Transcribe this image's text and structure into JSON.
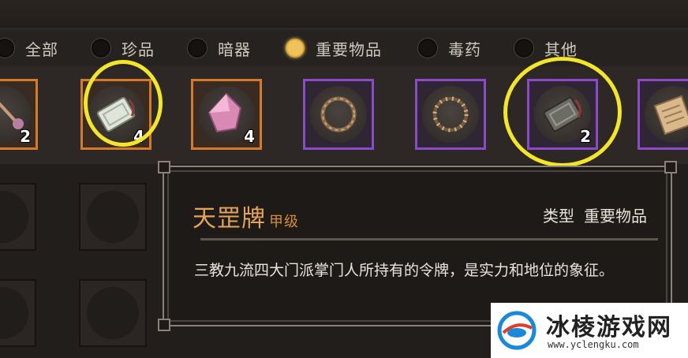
{
  "tabs": [
    {
      "label": "全部",
      "selected": false
    },
    {
      "label": "珍品",
      "selected": false
    },
    {
      "label": "暗器",
      "selected": false
    },
    {
      "label": "重要物品",
      "selected": true
    },
    {
      "label": "毒药",
      "selected": false
    },
    {
      "label": "其他",
      "selected": false
    }
  ],
  "items": [
    {
      "icon": "key-ornament-icon",
      "count": "2",
      "rarity": "orange"
    },
    {
      "icon": "jade-token-icon",
      "count": "4",
      "rarity": "orange"
    },
    {
      "icon": "pink-crystal-icon",
      "count": "4",
      "rarity": "orange"
    },
    {
      "icon": "rope-ring-icon",
      "count": "",
      "rarity": "purple"
    },
    {
      "icon": "bead-ring-icon",
      "count": "",
      "rarity": "purple"
    },
    {
      "icon": "iron-token-icon",
      "count": "2",
      "rarity": "purple"
    },
    {
      "icon": "scroll-icon",
      "count": "",
      "rarity": "purple"
    }
  ],
  "tooltip": {
    "name": "天罡牌",
    "grade": "甲级",
    "type_label": "类型",
    "type_value": "重要物品",
    "description": "三教九流四大门派掌门人所持有的令牌，是实力和地位的象征。"
  },
  "watermark": {
    "title": "冰棱游戏网",
    "url": "www.yclengku.com"
  },
  "colors": {
    "highlight_ring": "#f2e52a",
    "orange_border": "#d47a2a",
    "purple_border": "#8b4bc9",
    "item_name": "#e4a45a",
    "selected_radio": "#f0c25a"
  }
}
